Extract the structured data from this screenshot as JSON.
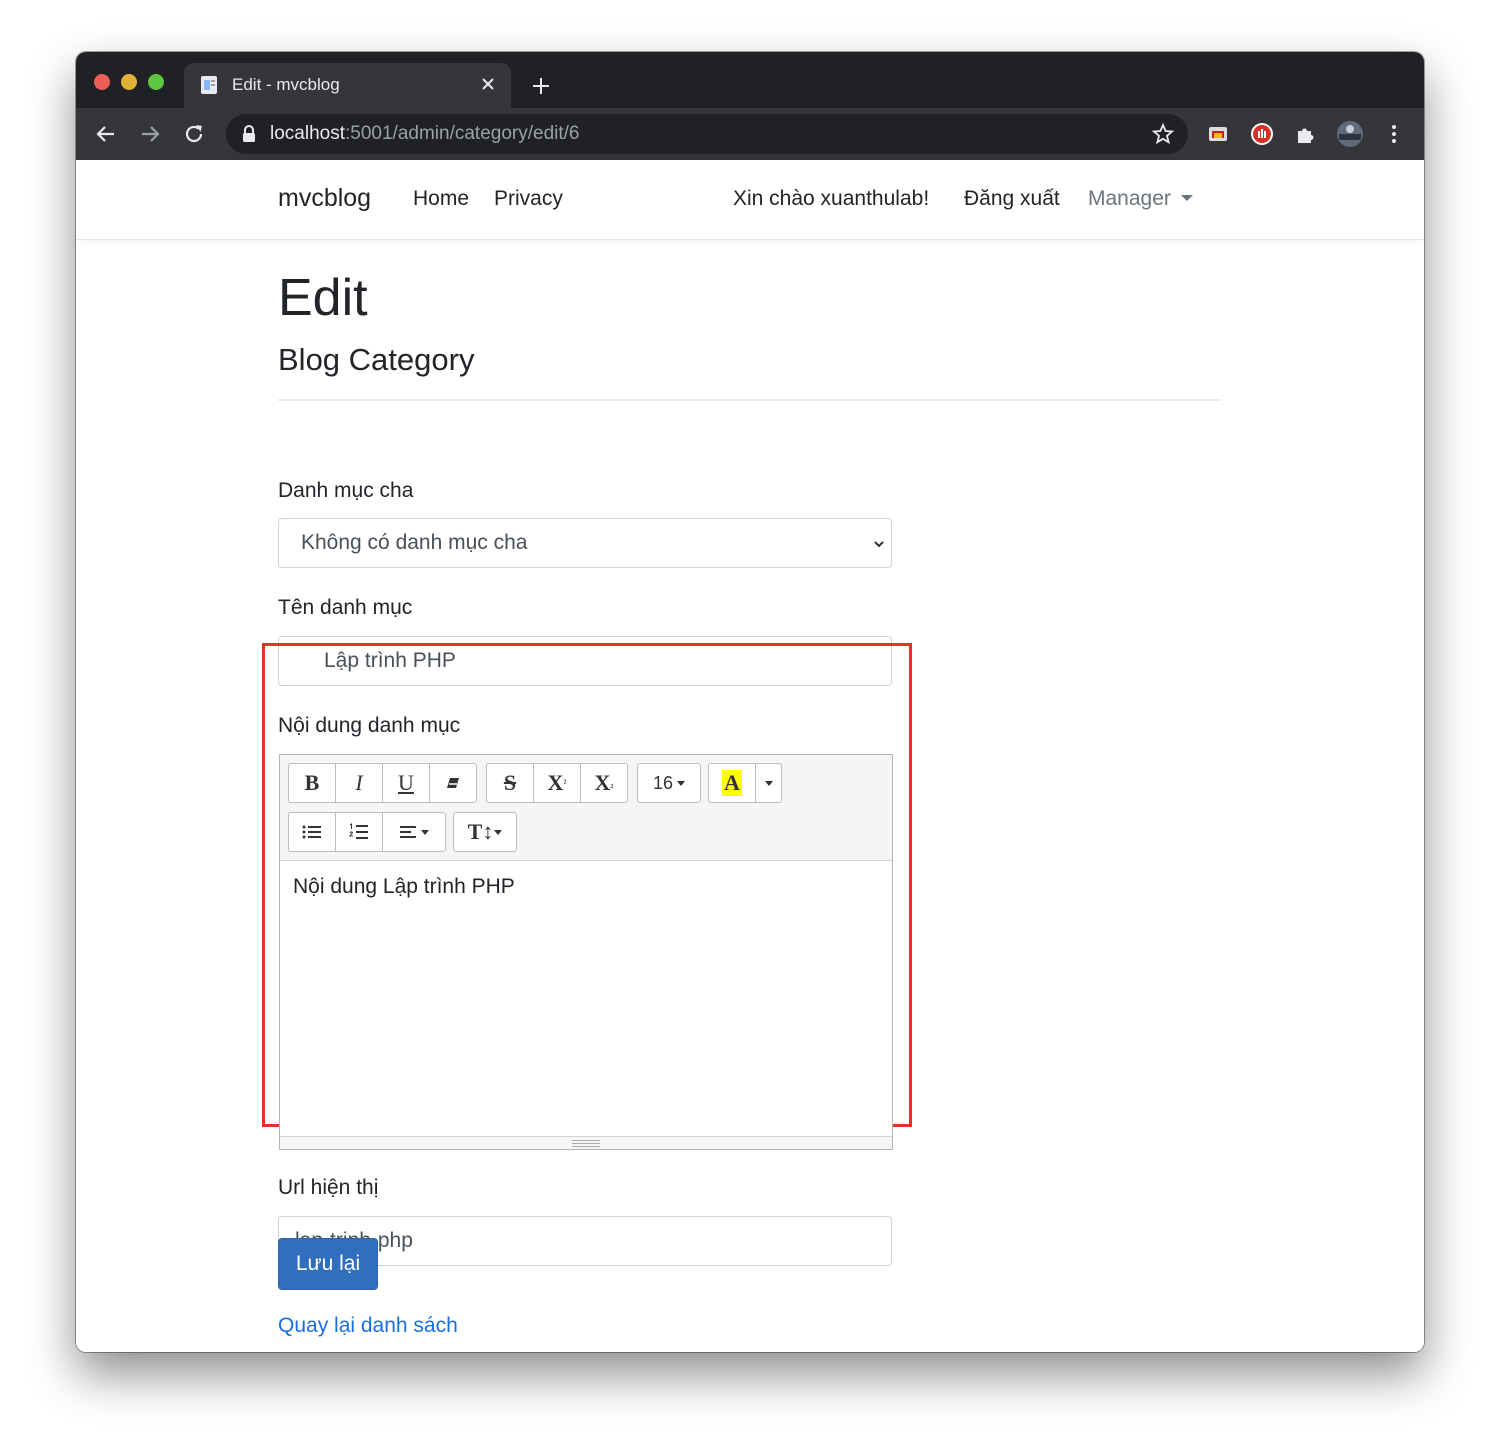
{
  "browser": {
    "tab_title": "Edit - mvcblog",
    "url_host": "localhost",
    "url_path": ":5001/admin/category/edit/6"
  },
  "navbar": {
    "brand": "mvcblog",
    "links": [
      "Home",
      "Privacy"
    ],
    "greeting": "Xin chào xuanthulab!",
    "logout": "Đăng xuất",
    "manager": "Manager"
  },
  "page": {
    "title": "Edit",
    "subtitle": "Blog Category"
  },
  "form": {
    "parent_label": "Danh mục cha",
    "parent_value": "Không có danh mục cha",
    "name_label": "Tên danh mục",
    "name_value": "Lập trình PHP",
    "content_label": "Nội dung danh mục",
    "content_value": "Nội dung Lập trình PHP",
    "url_label": "Url hiện thị",
    "url_value": "lap-trinh-php",
    "save_label": "Lưu lại",
    "back_label": "Quay lại danh sách"
  },
  "editor_toolbar": {
    "bold": "B",
    "italic": "I",
    "underline": "U",
    "strike": "S",
    "superscript": "X",
    "superscript_mark": "²",
    "subscript": "X",
    "subscript_mark": "₂",
    "font_size": "16",
    "color_letter": "A",
    "font_family": "T↕"
  },
  "colors": {
    "highlight_border": "#e53228",
    "primary": "#2f6fbd",
    "link": "#1a6fde"
  }
}
